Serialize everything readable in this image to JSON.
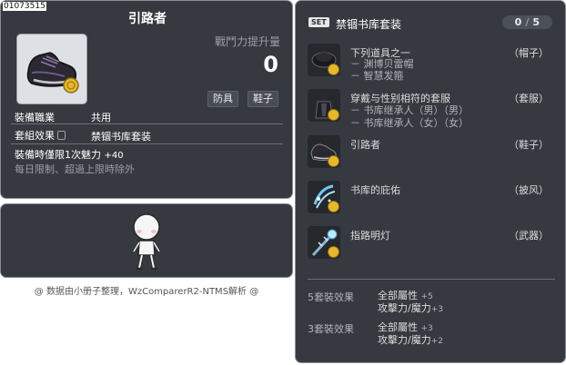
{
  "item": {
    "id": "01073515",
    "title": "引路者",
    "power_label": "戰鬥力提升量",
    "power_value": "0",
    "tags": [
      "防具",
      "鞋子"
    ],
    "job_label": "裝備職業",
    "job_value": "共用",
    "set_label": "套組效果",
    "set_value": "禁锢书库套装",
    "time_limit_label": "裝備時僅限1次魅力",
    "time_limit_value": "+40",
    "daily_note": "每日限制、超過上限時除外"
  },
  "watermark": "@ 数据由小册子整理，WzComparerR2-NTMS解析 @",
  "set": {
    "badge": "SET",
    "name": "禁锢书库套装",
    "owned": "0",
    "total": "5",
    "items": [
      {
        "name": "下列道具之一",
        "type": "（帽子）",
        "icon": "black-cap-icon",
        "subs": [
          "－ 渊博贝雷帽",
          "－ 智慧发箍"
        ]
      },
      {
        "name": "穿戴与性别相符的套服",
        "type": "（套服）",
        "icon": "robe-icon",
        "subs": [
          "－ 书库继承人（男）（男）",
          "－ 书库继承人（女）（女）"
        ]
      },
      {
        "name": "引路者",
        "type": "（鞋子）",
        "icon": "shoe-icon",
        "subs": []
      },
      {
        "name": "书库的庇佑",
        "type": "（披风）",
        "icon": "cape-icon",
        "subs": []
      },
      {
        "name": "指路明灯",
        "type": "（武器）",
        "icon": "staff-icon",
        "subs": []
      }
    ],
    "effects": [
      {
        "label": "5套裝效果",
        "lines": [
          {
            "text": "全部屬性",
            "num": "+5"
          },
          {
            "text": "攻擊力/魔力",
            "num": "+3"
          }
        ]
      },
      {
        "label": "3套裝效果",
        "lines": [
          {
            "text": "全部屬性",
            "num": "+3"
          },
          {
            "text": "攻擊力/魔力",
            "num": "+2"
          }
        ]
      }
    ]
  },
  "colors": {
    "panel_bg": "#36393f",
    "panel_border": "#8a8e96",
    "coin": "#e6b82e"
  }
}
